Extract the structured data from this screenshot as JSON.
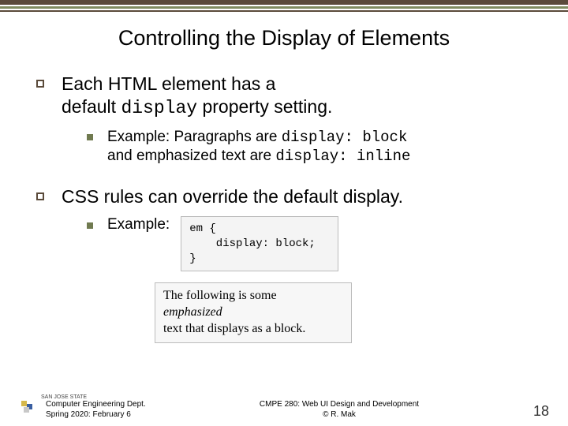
{
  "title": "Controlling the Display of Elements",
  "bullets": {
    "first": {
      "line1": "Each HTML element has a",
      "line2_a": "default ",
      "line2_mono": "display",
      "line2_b": " property setting."
    },
    "first_sub": {
      "pre": "Example: Paragraphs are ",
      "code1": "display: block",
      "mid": " and emphasized text are ",
      "code2": "display: inline"
    },
    "second": "CSS rules can override the default display.",
    "second_sub": {
      "label": "Example:",
      "code": "em {\n    display: block;\n}"
    }
  },
  "result": {
    "line1": "The following is some",
    "line2": "emphasized",
    "line3": "text that displays as a block."
  },
  "footer": {
    "logo_text": "SAN JOSE STATE",
    "dept_line1": "Computer Engineering Dept.",
    "dept_line2": "Spring 2020: February 6",
    "center_line1": "CMPE 280: Web UI Design and Development",
    "center_line2": "© R. Mak",
    "page_number": "18"
  }
}
